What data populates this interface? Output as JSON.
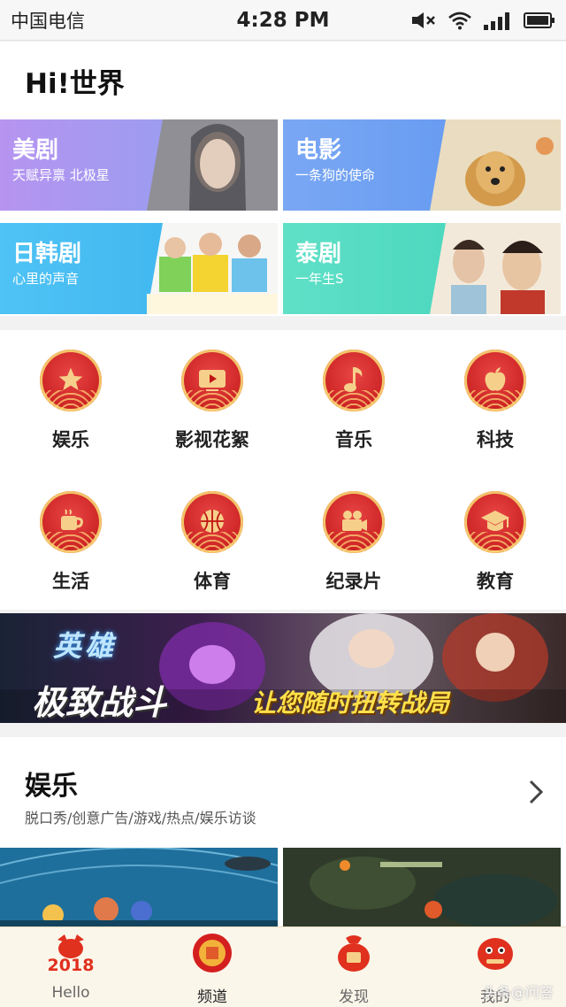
{
  "status_bar": {
    "carrier": "中国电信",
    "time": "4:28 PM"
  },
  "header": {
    "greeting": "Hi!世界"
  },
  "banners": [
    {
      "title": "美剧",
      "subtitle": "天赋异禀 北极星",
      "color": "#a79af0"
    },
    {
      "title": "电影",
      "subtitle": "一条狗的使命",
      "color": "#6b9ef2"
    },
    {
      "title": "日韩剧",
      "subtitle": "心里的声音",
      "color": "#44bbf1"
    },
    {
      "title": "泰剧",
      "subtitle": "一年生S",
      "color": "#4fdac0"
    }
  ],
  "channels": [
    {
      "label": "娱乐",
      "icon": "star-icon"
    },
    {
      "label": "影视花絮",
      "icon": "video-icon"
    },
    {
      "label": "音乐",
      "icon": "music-note-icon"
    },
    {
      "label": "科技",
      "icon": "apple-icon"
    },
    {
      "label": "生活",
      "icon": "coffee-cup-icon"
    },
    {
      "label": "体育",
      "icon": "basketball-icon"
    },
    {
      "label": "纪录片",
      "icon": "camera-icon"
    },
    {
      "label": "教育",
      "icon": "graduation-cap-icon"
    }
  ],
  "ad_banner": {
    "headline": "极致战斗",
    "tagline": "让您随时扭转战局",
    "logo_text": "英雄"
  },
  "section": {
    "title": "娱乐",
    "subtitle": "脱口秀/创意广告/游戏/热点/娱乐访谈"
  },
  "tabbar": {
    "tabs": [
      {
        "label": "Hello",
        "badge": "2018"
      },
      {
        "label": "频道",
        "active": true
      },
      {
        "label": "发现"
      },
      {
        "label": "我的"
      }
    ]
  },
  "watermark": "头条@问答",
  "colors": {
    "accent_red": "#d41f1f",
    "gold": "#f3c36a"
  }
}
